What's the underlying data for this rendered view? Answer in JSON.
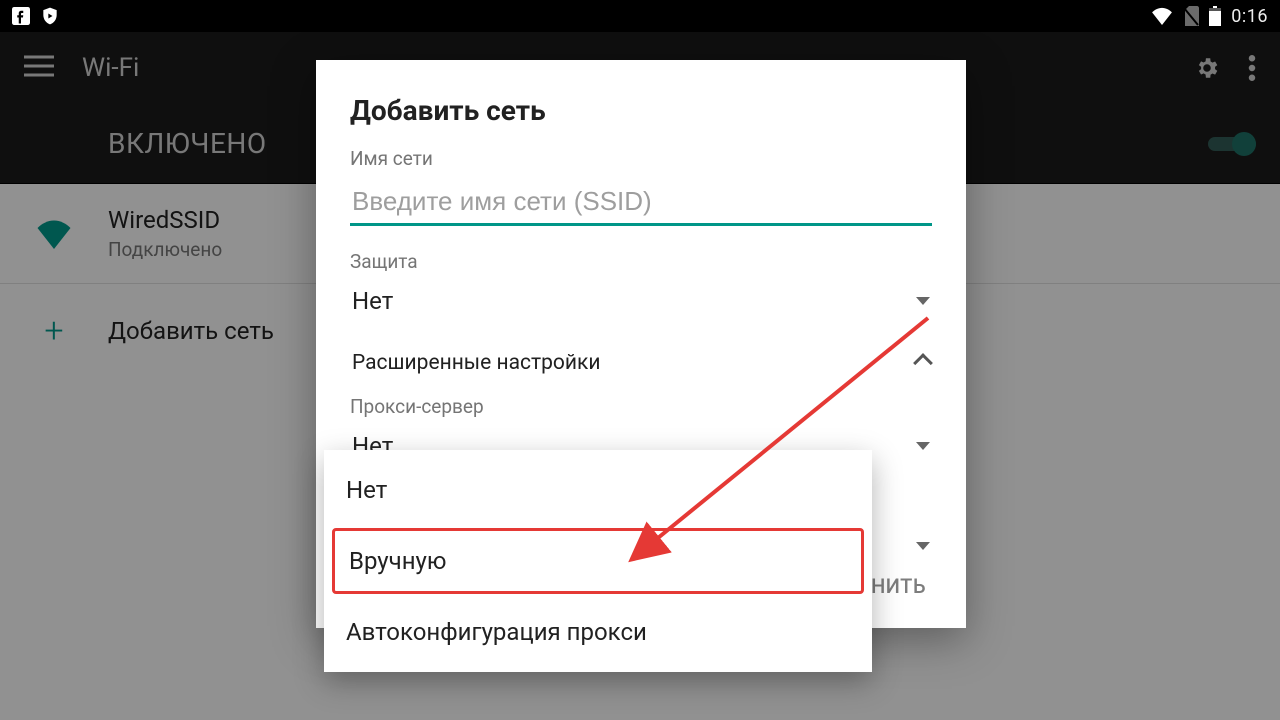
{
  "statusbar": {
    "clock": "0:16"
  },
  "appbar": {
    "title": "Wi-Fi"
  },
  "wifi_toggle": {
    "label": "ВКЛЮЧЕНО"
  },
  "network": {
    "name": "WiredSSID",
    "status": "Подключено"
  },
  "add_network_row": {
    "label": "Добавить сеть"
  },
  "dialog": {
    "title": "Добавить сеть",
    "ssid_label": "Имя сети",
    "ssid_placeholder": "Введите имя сети (SSID)",
    "ssid_value": "",
    "security_label": "Защита",
    "security_value": "Нет",
    "advanced_label": "Расширенные настройки",
    "proxy_label": "Прокси-сервер",
    "proxy_value": "Нет",
    "save_partial": "АНИТЬ"
  },
  "proxy_menu": {
    "options": [
      "Нет",
      "Вручную",
      "Автоконфигурация прокси"
    ]
  },
  "colors": {
    "accent": "#009688",
    "annotation": "#e53935"
  }
}
